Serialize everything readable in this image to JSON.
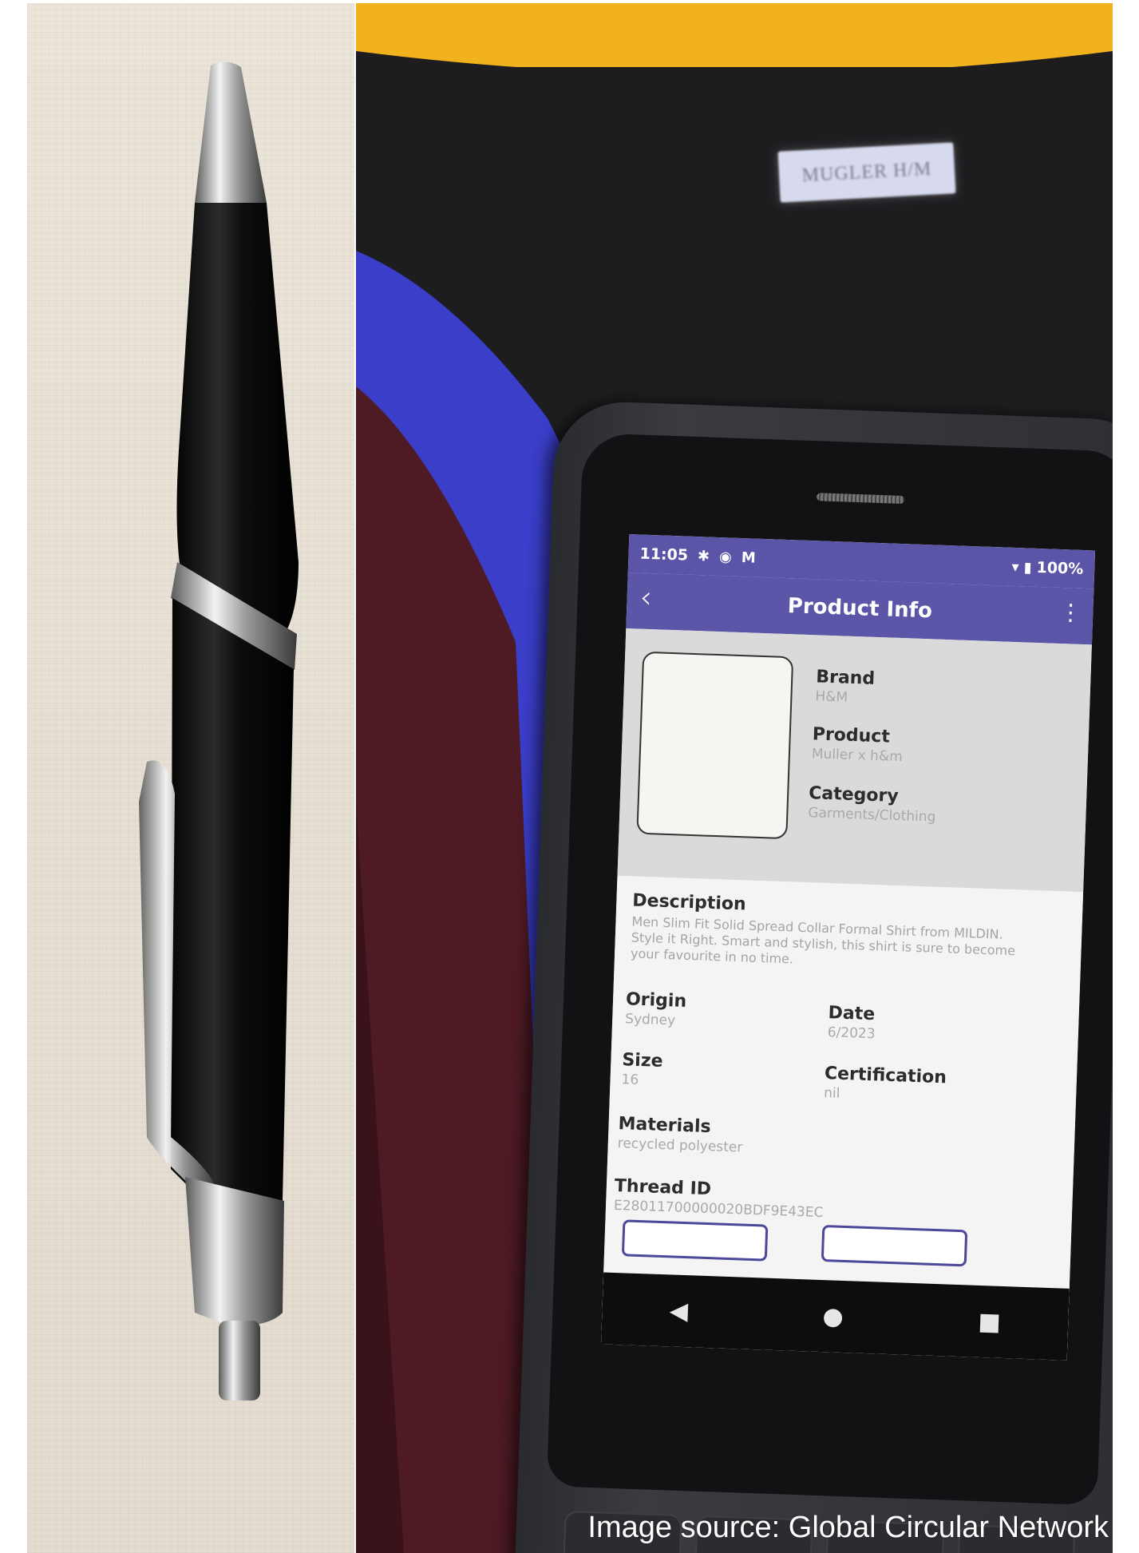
{
  "device": {
    "status_bar": {
      "time": "11:05",
      "battery": "100%"
    },
    "app_bar": {
      "back_icon": "chevron-left-icon",
      "title": "Product Info",
      "menu_icon": "more-vert-icon"
    },
    "product": {
      "brand_label": "Brand",
      "brand_value": "H&M",
      "product_label": "Product",
      "product_value": "Muller x h&m",
      "category_label": "Category",
      "category_value": "Garments/Clothing"
    },
    "details": {
      "description_label": "Description",
      "description_value": "Men Slim Fit Solid Spread Collar Formal Shirt from MILDIN. Style it Right. Smart and stylish, this shirt is sure to become your favourite in no time.",
      "origin_label": "Origin",
      "origin_value": "Sydney",
      "date_label": "Date",
      "date_value": "6/2023",
      "size_label": "Size",
      "size_value": "16",
      "certification_label": "Certification",
      "certification_value": "nil",
      "materials_label": "Materials",
      "materials_value": "recycled polyester",
      "thread_id_label": "Thread ID",
      "thread_id_value": "E28011700000020BDF9E43EC"
    },
    "nav": {
      "back": "◀",
      "home": "●",
      "recents": "■"
    }
  },
  "shirt_label_text": "MUGLER H/M",
  "caption": "Image source: Global Circular Network",
  "colors": {
    "app_bar": "#5b56a8",
    "button_border": "#4b4899",
    "shirt_blue": "#3a3ec8",
    "shirt_burgundy": "#4e1a24",
    "shirt_black": "#1d1c1f",
    "yellow_background": "#f1b21d"
  }
}
